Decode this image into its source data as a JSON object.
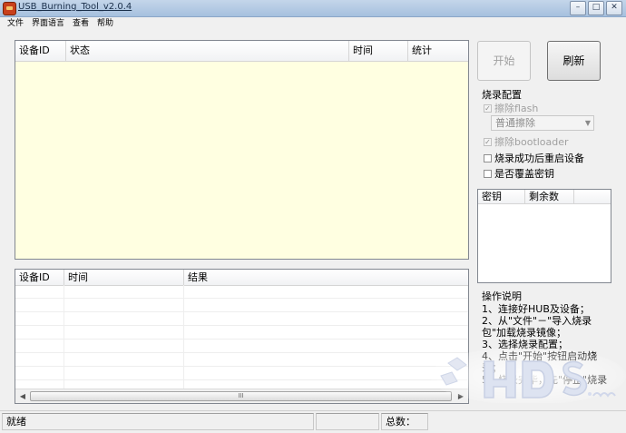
{
  "window": {
    "title": "USB_Burning_Tool_v2.0.4",
    "controls": [
      "–",
      "□",
      "✕"
    ]
  },
  "menu": [
    "文件",
    "界面语言",
    "查看",
    "帮助"
  ],
  "main_table": {
    "columns": [
      "设备ID",
      "状态",
      "时间",
      "统计"
    ]
  },
  "log_table": {
    "columns": [
      "设备ID",
      "时间",
      "结果"
    ],
    "scroll_thumb": "III"
  },
  "buttons": {
    "start": "开始",
    "refresh": "刷新"
  },
  "burn_config": {
    "title": "烧录配置",
    "erase_flash": "擦除flash",
    "erase_mode": "普通擦除",
    "erase_bootloader": "擦除bootloader",
    "reboot_after_success": "烧录成功后重启设备",
    "overwrite_key": "是否覆盖密钥"
  },
  "key_table": {
    "columns": [
      "密钥",
      "剩余数"
    ]
  },
  "help": {
    "title": "操作说明",
    "text": "1、连接好HUB及设备；\n2、从\"文件\"－\"导入烧录包\"加载烧录镜像；\n3、选择烧录配置；\n4、点击\"开始\"按钮启动烧录；\n5、烧录完毕，先\"停止\"烧录"
  },
  "status": {
    "state": "就绪",
    "total_label": "总数："
  },
  "colors": {
    "grid_background": "#ffffe1",
    "titlebar": "#a6c0de"
  }
}
